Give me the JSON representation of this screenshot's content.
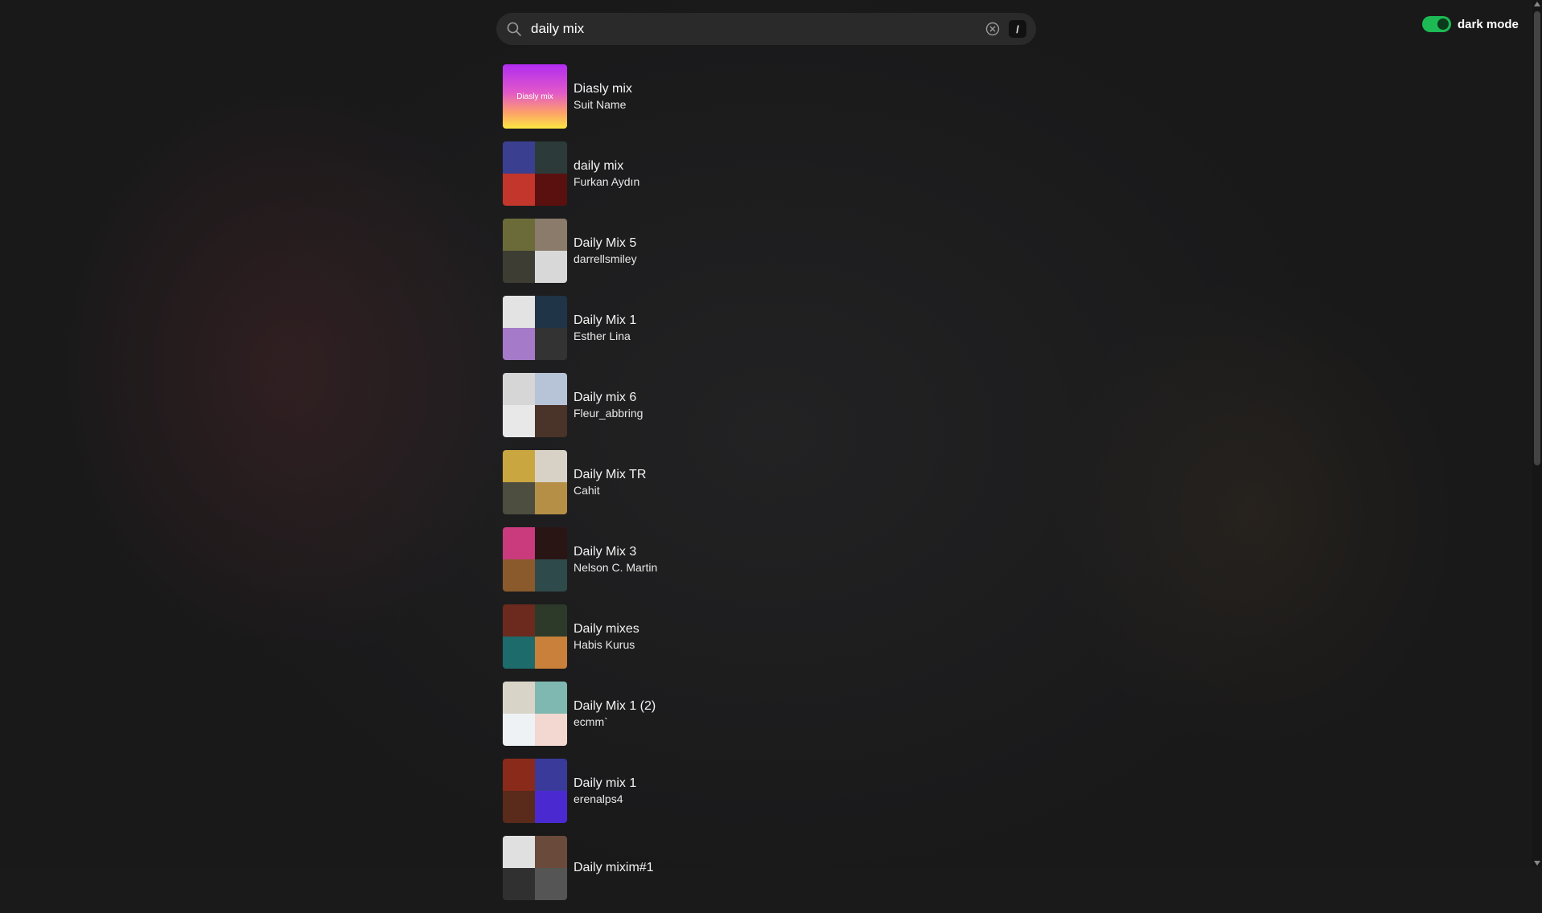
{
  "search": {
    "value": "daily mix",
    "slash_key": "/"
  },
  "dark_mode": {
    "label": "dark mode",
    "enabled": true,
    "accent": "#1db954"
  },
  "results": [
    {
      "title": "Diasly mix",
      "owner": "Suit Name",
      "cover_text": "Diasly mix",
      "cover": "single",
      "colors": [
        "#b12cf2",
        "#fde742"
      ]
    },
    {
      "title": "daily mix",
      "owner": "Furkan Aydın",
      "cover": "grid",
      "colors": [
        "#3b3f8f",
        "#2c3a3a",
        "#c2362b",
        "#5b1010"
      ]
    },
    {
      "title": "Daily Mix 5",
      "owner": "darrellsmiley",
      "cover": "grid",
      "colors": [
        "#6b6b3a",
        "#8a7b6a",
        "#3d3d33",
        "#d8d8d8"
      ]
    },
    {
      "title": "Daily Mix 1",
      "owner": "Esther Lina",
      "cover": "grid",
      "colors": [
        "#e3e3e3",
        "#1f3446",
        "#a57ac8",
        "#333333"
      ]
    },
    {
      "title": "Daily mix 6",
      "owner": "Fleur_abbring",
      "cover": "grid",
      "colors": [
        "#d6d6d6",
        "#b7c3d6",
        "#e8e8e8",
        "#4a3328"
      ]
    },
    {
      "title": "Daily Mix TR",
      "owner": "Cahit",
      "cover": "grid",
      "colors": [
        "#c9a640",
        "#d8d2c6",
        "#4d4d40",
        "#b68f47"
      ]
    },
    {
      "title": "Daily Mix 3",
      "owner": "Nelson C. Martin",
      "cover": "grid",
      "colors": [
        "#c93b7c",
        "#2a1515",
        "#8a5a2c",
        "#2f4a4a"
      ]
    },
    {
      "title": "Daily mixes",
      "owner": "Habis Kurus",
      "cover": "grid",
      "colors": [
        "#6b2a1d",
        "#2d3a2a",
        "#1d6b6b",
        "#c8803a"
      ]
    },
    {
      "title": "Daily Mix 1 (2)",
      "owner": "ecmm`",
      "cover": "grid",
      "colors": [
        "#d9d4c8",
        "#7fb8b0",
        "#eef2f5",
        "#f2d8d0"
      ]
    },
    {
      "title": "Daily mix 1",
      "owner": "erenalps4",
      "cover": "grid",
      "colors": [
        "#8a2a1a",
        "#3a3a9a",
        "#5a2a1a",
        "#4a2ad0"
      ]
    },
    {
      "title": "Daily mixim#1",
      "owner": "",
      "cover": "grid",
      "colors": [
        "#e0e0e0",
        "#6a4a3a",
        "#303030",
        "#555555"
      ]
    }
  ]
}
